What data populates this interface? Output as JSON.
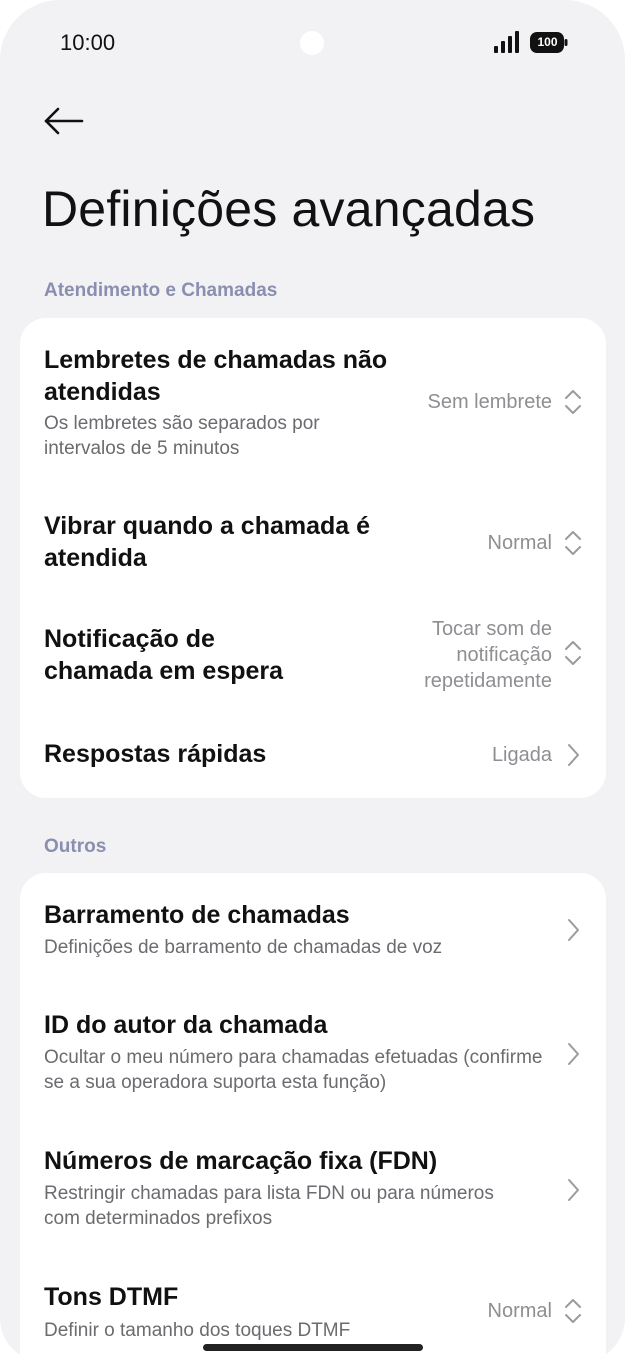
{
  "status_bar": {
    "time": "10:00",
    "battery": "100",
    "signal_icon": "signal-bars-icon",
    "battery_icon": "battery-icon"
  },
  "header": {
    "back_icon": "arrow-left-icon",
    "title": "Definições avançadas"
  },
  "sections": [
    {
      "header": "Atendimento e Chamadas",
      "items": [
        {
          "title": "Lembretes de chamadas não atendidas",
          "subtitle": "Os lembretes são separados por intervalos de 5 minutos",
          "value": "Sem lembrete",
          "icon": "chevron-up-down-icon"
        },
        {
          "title": "Vibrar quando a chamada é atendida",
          "value": "Normal",
          "icon": "chevron-up-down-icon"
        },
        {
          "title": "Notificação de chamada em espera",
          "value": "Tocar som de notificação repetidamente",
          "icon": "chevron-up-down-icon"
        },
        {
          "title": "Respostas rápidas",
          "value": "Ligada",
          "icon": "chevron-right-icon"
        }
      ]
    },
    {
      "header": "Outros",
      "items": [
        {
          "title": "Barramento de chamadas",
          "subtitle": "Definições de barramento de chamadas de voz",
          "icon": "chevron-right-icon"
        },
        {
          "title": "ID do autor da chamada",
          "subtitle": "Ocultar o meu número para chamadas efetuadas (confirme se a sua operadora suporta esta função)",
          "icon": "chevron-right-icon"
        },
        {
          "title": "Números de marcação fixa (FDN)",
          "subtitle": "Restringir chamadas para lista FDN ou para números com determinados prefixos",
          "icon": "chevron-right-icon"
        },
        {
          "title": "Tons DTMF",
          "subtitle": "Definir o tamanho dos toques DTMF",
          "value": "Normal",
          "icon": "chevron-up-down-icon"
        }
      ]
    }
  ]
}
